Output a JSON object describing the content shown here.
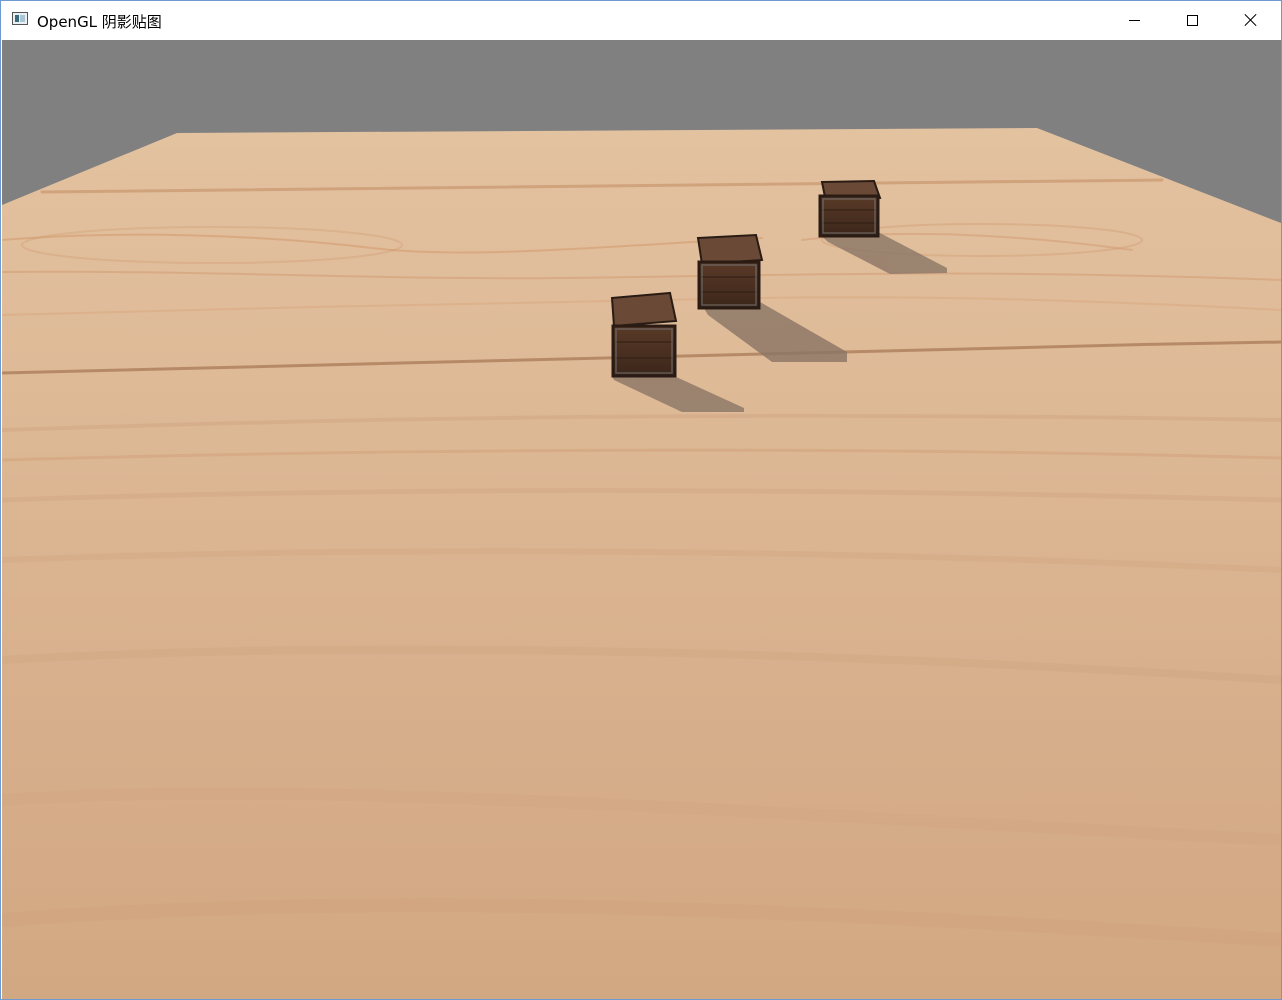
{
  "window": {
    "title": "OpenGL 阴影贴图",
    "app_icon": "opengl-app-icon",
    "controls": {
      "minimize_icon": "minimize-icon",
      "maximize_icon": "maximize-icon",
      "close_icon": "close-icon"
    }
  },
  "scene": {
    "background_color": "#808080",
    "floor_color": "#dcb593",
    "crate_color": "#4a3022",
    "shadow_color": "#8a7565",
    "crate_count": 3
  }
}
